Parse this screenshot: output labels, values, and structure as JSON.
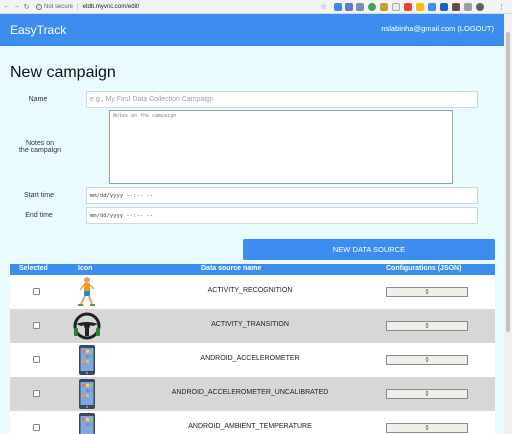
{
  "browser": {
    "security_label": "Not secure",
    "url": "etdb.myvnc.com/edit/"
  },
  "app": {
    "brand": "EasyTrack",
    "user": "nslabinha@gmail.com (LOGOUT)"
  },
  "page": {
    "title": "New campaign"
  },
  "form": {
    "name_label": "Name",
    "name_placeholder": "e.g., My First Data Collection Campaign",
    "notes_label_line1": "Notes on",
    "notes_label_line2": "the campaign",
    "notes_placeholder": "Notes on the campaign",
    "start_label": "Start time",
    "start_value": "mm/dd/yyyy --:-- --",
    "end_label": "End time",
    "end_value": "mm/dd/yyyy --:-- --",
    "new_source_button": "NEW DATA SOURCE"
  },
  "table": {
    "headers": {
      "selected": "Selected",
      "icon": "Icon",
      "name": "Data source name",
      "config": "Configurations (JSON)"
    },
    "rows": [
      {
        "name": "ACTIVITY_RECOGNITION",
        "config": "{}",
        "icon": "runner-icon"
      },
      {
        "name": "ACTIVITY_TRANSITION",
        "config": "{}",
        "icon": "steering-wheel-icon"
      },
      {
        "name": "ANDROID_ACCELEROMETER",
        "config": "{}",
        "icon": "phone-icon"
      },
      {
        "name": "ANDROID_ACCELEROMETER_UNCALIBRATED",
        "config": "{}",
        "icon": "phone-icon"
      },
      {
        "name": "ANDROID_AMBIENT_TEMPERATURE",
        "config": "{}",
        "icon": "phone-icon"
      }
    ]
  },
  "colors": {
    "accent": "#3d8df0",
    "background": "#e9fbff",
    "row_alt": "#d7d7d7"
  }
}
